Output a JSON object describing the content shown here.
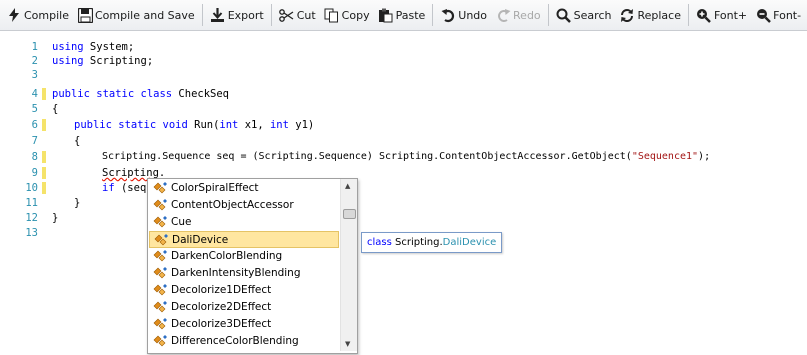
{
  "toolbar": {
    "compile": "Compile",
    "compile_save": "Compile and Save",
    "export": "Export",
    "cut": "Cut",
    "copy": "Copy",
    "paste": "Paste",
    "undo": "Undo",
    "redo": "Redo",
    "search": "Search",
    "replace": "Replace",
    "font_plus": "Font+",
    "font_minus": "Font-"
  },
  "editor": {
    "lines": [
      {
        "n": "1",
        "changed": false
      },
      {
        "n": "2",
        "changed": false
      },
      {
        "n": "3",
        "changed": false
      },
      {
        "n": "4",
        "changed": true
      },
      {
        "n": "5",
        "changed": false
      },
      {
        "n": "6",
        "changed": true
      },
      {
        "n": "7",
        "changed": false
      },
      {
        "n": "8",
        "changed": true
      },
      {
        "n": "9",
        "changed": true
      },
      {
        "n": "10",
        "changed": true
      },
      {
        "n": "11",
        "changed": false
      },
      {
        "n": "12",
        "changed": false
      },
      {
        "n": "13",
        "changed": false
      }
    ],
    "code": {
      "l1_kw": "using",
      "l1_rest": " System;",
      "l2_kw": "using",
      "l2_rest": " Scripting;",
      "l4_kw": "public static class",
      "l4_rest": " CheckSeq",
      "l5": "{",
      "l6_kw1": "public static void",
      "l6_mid1": " Run(",
      "l6_kw2": "int",
      "l6_mid2": " x1, ",
      "l6_kw3": "int",
      "l6_end": " y1)",
      "l7": "{",
      "l8_pre": "Scripting.Sequence seq = (Scripting.Sequence) Scripting.ContentObjectAccessor.GetObject(",
      "l8_str": "\"Sequence1\"",
      "l8_end": ");",
      "l9_a": "Scripting",
      "l9_b": ".",
      "l10_kw": "if",
      "l10_rest": " (seq",
      "l11": "}",
      "l12": "}"
    }
  },
  "completion": {
    "items": [
      "ColorSpiralEffect",
      "ContentObjectAccessor",
      "Cue",
      "DaliDevice",
      "DarkenColorBlending",
      "DarkenIntensityBlending",
      "Decolorize1DEffect",
      "Decolorize2DEffect",
      "Decolorize3DEffect",
      "DifferenceColorBlending"
    ],
    "selected": "DaliDevice",
    "tooltip": {
      "keyword": "class",
      "namespace": "Scripting.",
      "type": "DaliDevice"
    }
  },
  "colors": {
    "keyword": "#0000ff",
    "string": "#a31515",
    "line_number": "#2b91af",
    "change_marker": "#f5e36a",
    "selection": "#ffe6a0"
  },
  "icons": [
    "lightning-icon",
    "save-icon",
    "export-icon",
    "cut-icon",
    "copy-icon",
    "paste-icon",
    "undo-icon",
    "redo-icon",
    "search-icon",
    "replace-icon",
    "zoom-in-icon",
    "zoom-out-icon",
    "class-icon"
  ]
}
